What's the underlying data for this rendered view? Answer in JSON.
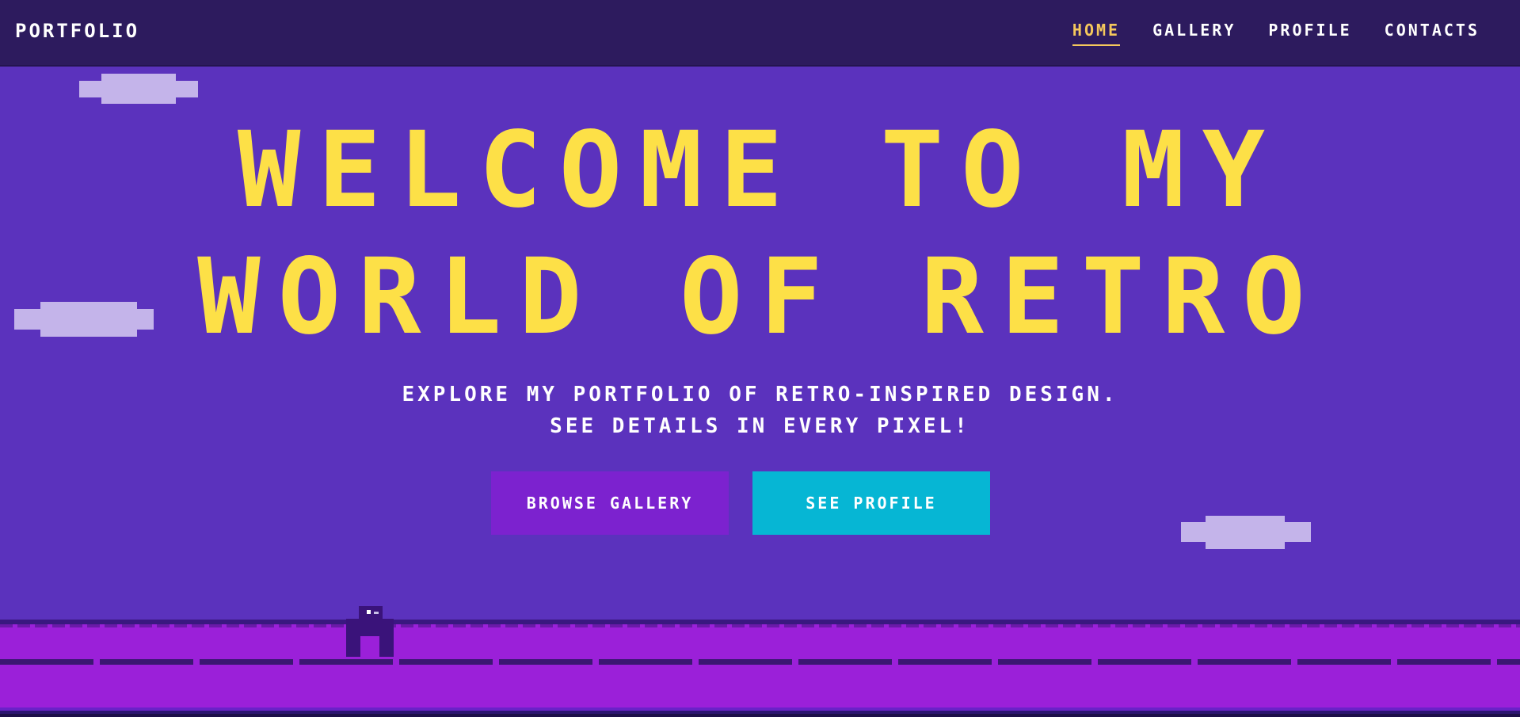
{
  "brand": "PORTFOLIO",
  "nav": {
    "items": [
      {
        "label": "HOME",
        "active": true
      },
      {
        "label": "GALLERY",
        "active": false
      },
      {
        "label": "PROFILE",
        "active": false
      },
      {
        "label": "CONTACTS",
        "active": false
      }
    ]
  },
  "hero": {
    "title_line1": "WELCOME TO MY",
    "title_line2": "WORLD OF RETRO",
    "subtitle_line1": "EXPLORE MY PORTFOLIO OF RETRO-INSPIRED DESIGN.",
    "subtitle_line2": "SEE DETAILS IN EVERY PIXEL!"
  },
  "buttons": {
    "browse_gallery": "BROWSE GALLERY",
    "see_profile": "SEE PROFILE"
  },
  "colors": {
    "background": "#5b32bd",
    "nav_background": "#2d1b5e",
    "title": "#fde047",
    "nav_active": "#f5c85c",
    "gallery_button": "#7c22cf",
    "profile_button": "#06b6d4",
    "ground": "#9b20d9",
    "cloud": "#c4b4ea"
  }
}
